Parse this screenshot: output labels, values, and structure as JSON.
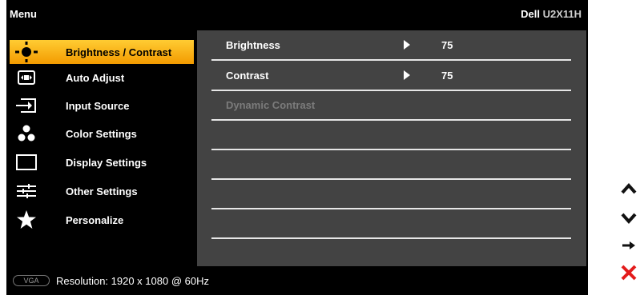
{
  "header": {
    "menu_title": "Menu",
    "brand": "Dell",
    "model": "U2X11H"
  },
  "sidebar": {
    "items": [
      {
        "label": "Brightness / Contrast",
        "icon": "brightness-icon",
        "active": true
      },
      {
        "label": "Auto Adjust",
        "icon": "auto-adjust-icon"
      },
      {
        "label": "Input Source",
        "icon": "input-source-icon"
      },
      {
        "label": "Color Settings",
        "icon": "color-settings-icon"
      },
      {
        "label": "Display Settings",
        "icon": "display-settings-icon"
      },
      {
        "label": "Other Settings",
        "icon": "other-settings-icon"
      },
      {
        "label": "Personalize",
        "icon": "personalize-star-icon"
      }
    ]
  },
  "content": {
    "rows": [
      {
        "label": "Brightness",
        "value": "75",
        "disabled": false
      },
      {
        "label": "Contrast",
        "value": "75",
        "disabled": false
      },
      {
        "label": "Dynamic Contrast",
        "value": "",
        "disabled": true
      },
      {
        "label": "",
        "value": ""
      },
      {
        "label": "",
        "value": ""
      },
      {
        "label": "",
        "value": ""
      },
      {
        "label": "",
        "value": ""
      }
    ]
  },
  "status": {
    "connector": "VGA",
    "resolution": "Resolution: 1920 x 1080 @ 60Hz"
  },
  "controls": [
    {
      "name": "up-icon"
    },
    {
      "name": "down-icon"
    },
    {
      "name": "enter-arrow-icon"
    },
    {
      "name": "exit-x-icon"
    }
  ],
  "colors": {
    "highlight": "#f5a800",
    "panel": "#434343",
    "exit": "#e31b1b"
  }
}
